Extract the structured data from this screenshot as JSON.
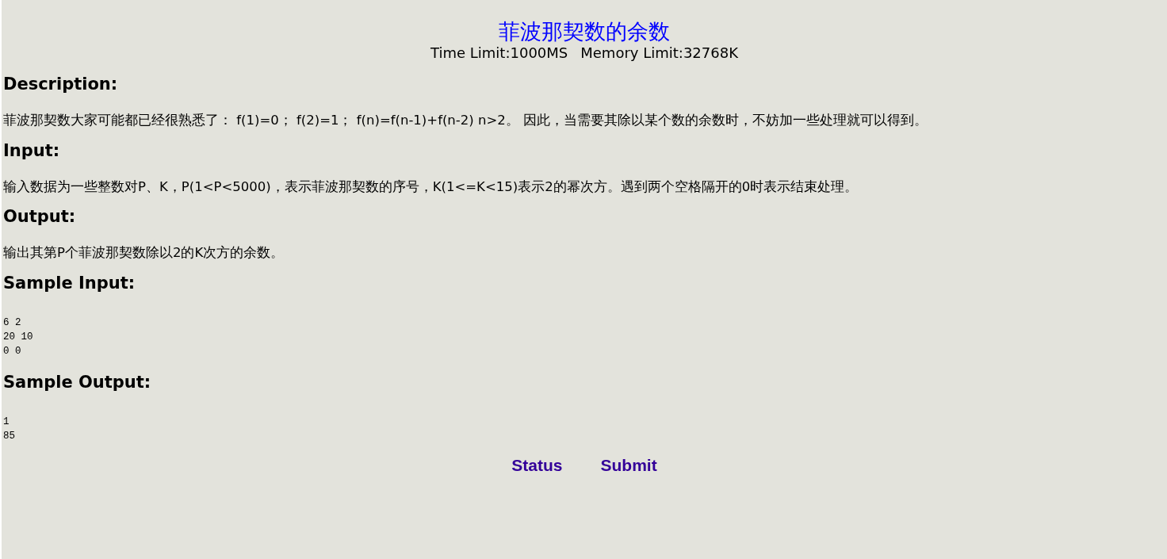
{
  "title": "菲波那契数的余数",
  "limits": [
    {
      "label": "Time Limit:1000MS"
    },
    {
      "label": "Memory Limit:32768K"
    }
  ],
  "sections": [
    {
      "heading": "Description:",
      "kind": "text",
      "body": "菲波那契数大家可能都已经很熟悉了： f(1)=0； f(2)=1； f(n)=f(n-1)+f(n-2) n>2。 因此，当需要其除以某个数的余数时，不妨加一些处理就可以得到。"
    },
    {
      "heading": "Input:",
      "kind": "text",
      "body": "输入数据为一些整数对P、K，P(1<P<5000)，表示菲波那契数的序号，K(1<=K<15)表示2的幂次方。遇到两个空格隔开的0时表示结束处理。"
    },
    {
      "heading": "Output:",
      "kind": "text",
      "body": "输出其第P个菲波那契数除以2的K次方的余数。"
    },
    {
      "heading": "Sample Input:",
      "kind": "pre",
      "body": "6 2\n20 10\n0 0"
    },
    {
      "heading": "Sample Output:",
      "kind": "pre",
      "body": "1\n85"
    }
  ],
  "links": [
    {
      "label": "Status"
    },
    {
      "label": "Submit"
    }
  ]
}
